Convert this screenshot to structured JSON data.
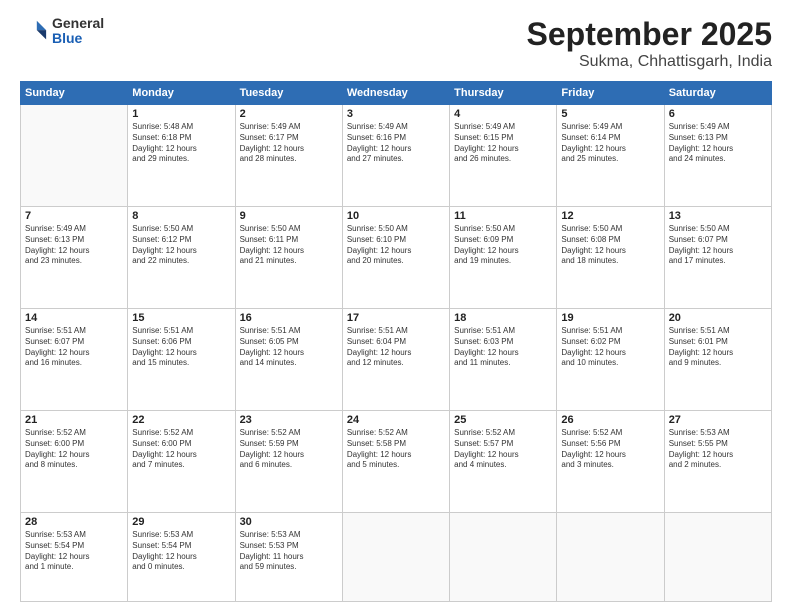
{
  "logo": {
    "general": "General",
    "blue": "Blue"
  },
  "title": {
    "month": "September 2025",
    "location": "Sukma, Chhattisgarh, India"
  },
  "weekdays": [
    "Sunday",
    "Monday",
    "Tuesday",
    "Wednesday",
    "Thursday",
    "Friday",
    "Saturday"
  ],
  "weeks": [
    [
      {
        "day": "",
        "text": ""
      },
      {
        "day": "1",
        "text": "Sunrise: 5:48 AM\nSunset: 6:18 PM\nDaylight: 12 hours\nand 29 minutes."
      },
      {
        "day": "2",
        "text": "Sunrise: 5:49 AM\nSunset: 6:17 PM\nDaylight: 12 hours\nand 28 minutes."
      },
      {
        "day": "3",
        "text": "Sunrise: 5:49 AM\nSunset: 6:16 PM\nDaylight: 12 hours\nand 27 minutes."
      },
      {
        "day": "4",
        "text": "Sunrise: 5:49 AM\nSunset: 6:15 PM\nDaylight: 12 hours\nand 26 minutes."
      },
      {
        "day": "5",
        "text": "Sunrise: 5:49 AM\nSunset: 6:14 PM\nDaylight: 12 hours\nand 25 minutes."
      },
      {
        "day": "6",
        "text": "Sunrise: 5:49 AM\nSunset: 6:13 PM\nDaylight: 12 hours\nand 24 minutes."
      }
    ],
    [
      {
        "day": "7",
        "text": "Sunrise: 5:49 AM\nSunset: 6:13 PM\nDaylight: 12 hours\nand 23 minutes."
      },
      {
        "day": "8",
        "text": "Sunrise: 5:50 AM\nSunset: 6:12 PM\nDaylight: 12 hours\nand 22 minutes."
      },
      {
        "day": "9",
        "text": "Sunrise: 5:50 AM\nSunset: 6:11 PM\nDaylight: 12 hours\nand 21 minutes."
      },
      {
        "day": "10",
        "text": "Sunrise: 5:50 AM\nSunset: 6:10 PM\nDaylight: 12 hours\nand 20 minutes."
      },
      {
        "day": "11",
        "text": "Sunrise: 5:50 AM\nSunset: 6:09 PM\nDaylight: 12 hours\nand 19 minutes."
      },
      {
        "day": "12",
        "text": "Sunrise: 5:50 AM\nSunset: 6:08 PM\nDaylight: 12 hours\nand 18 minutes."
      },
      {
        "day": "13",
        "text": "Sunrise: 5:50 AM\nSunset: 6:07 PM\nDaylight: 12 hours\nand 17 minutes."
      }
    ],
    [
      {
        "day": "14",
        "text": "Sunrise: 5:51 AM\nSunset: 6:07 PM\nDaylight: 12 hours\nand 16 minutes."
      },
      {
        "day": "15",
        "text": "Sunrise: 5:51 AM\nSunset: 6:06 PM\nDaylight: 12 hours\nand 15 minutes."
      },
      {
        "day": "16",
        "text": "Sunrise: 5:51 AM\nSunset: 6:05 PM\nDaylight: 12 hours\nand 14 minutes."
      },
      {
        "day": "17",
        "text": "Sunrise: 5:51 AM\nSunset: 6:04 PM\nDaylight: 12 hours\nand 12 minutes."
      },
      {
        "day": "18",
        "text": "Sunrise: 5:51 AM\nSunset: 6:03 PM\nDaylight: 12 hours\nand 11 minutes."
      },
      {
        "day": "19",
        "text": "Sunrise: 5:51 AM\nSunset: 6:02 PM\nDaylight: 12 hours\nand 10 minutes."
      },
      {
        "day": "20",
        "text": "Sunrise: 5:51 AM\nSunset: 6:01 PM\nDaylight: 12 hours\nand 9 minutes."
      }
    ],
    [
      {
        "day": "21",
        "text": "Sunrise: 5:52 AM\nSunset: 6:00 PM\nDaylight: 12 hours\nand 8 minutes."
      },
      {
        "day": "22",
        "text": "Sunrise: 5:52 AM\nSunset: 6:00 PM\nDaylight: 12 hours\nand 7 minutes."
      },
      {
        "day": "23",
        "text": "Sunrise: 5:52 AM\nSunset: 5:59 PM\nDaylight: 12 hours\nand 6 minutes."
      },
      {
        "day": "24",
        "text": "Sunrise: 5:52 AM\nSunset: 5:58 PM\nDaylight: 12 hours\nand 5 minutes."
      },
      {
        "day": "25",
        "text": "Sunrise: 5:52 AM\nSunset: 5:57 PM\nDaylight: 12 hours\nand 4 minutes."
      },
      {
        "day": "26",
        "text": "Sunrise: 5:52 AM\nSunset: 5:56 PM\nDaylight: 12 hours\nand 3 minutes."
      },
      {
        "day": "27",
        "text": "Sunrise: 5:53 AM\nSunset: 5:55 PM\nDaylight: 12 hours\nand 2 minutes."
      }
    ],
    [
      {
        "day": "28",
        "text": "Sunrise: 5:53 AM\nSunset: 5:54 PM\nDaylight: 12 hours\nand 1 minute."
      },
      {
        "day": "29",
        "text": "Sunrise: 5:53 AM\nSunset: 5:54 PM\nDaylight: 12 hours\nand 0 minutes."
      },
      {
        "day": "30",
        "text": "Sunrise: 5:53 AM\nSunset: 5:53 PM\nDaylight: 11 hours\nand 59 minutes."
      },
      {
        "day": "",
        "text": ""
      },
      {
        "day": "",
        "text": ""
      },
      {
        "day": "",
        "text": ""
      },
      {
        "day": "",
        "text": ""
      }
    ]
  ]
}
